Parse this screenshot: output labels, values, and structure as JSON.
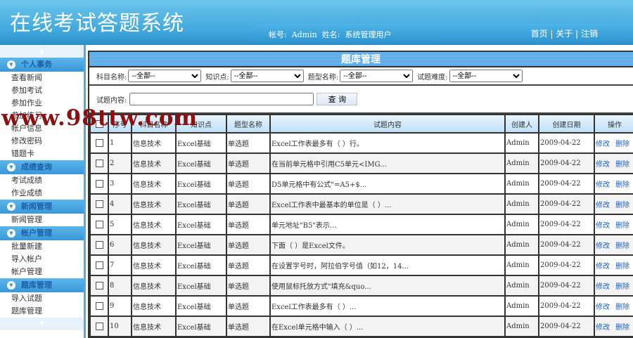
{
  "header": {
    "title": "在线考试答题系统",
    "account_label": "帐号:",
    "account": "Admin",
    "name_label": "姓名:",
    "name": "系统管理用户",
    "links": [
      "首页",
      "关于",
      "注销"
    ]
  },
  "sidebar": {
    "sections": [
      {
        "title": "个人事务",
        "items": [
          "查看新闻",
          "参加考试",
          "参加作业",
          "参加练习",
          "帐户信息",
          "修改密码",
          "错题卡"
        ]
      },
      {
        "title": "成绩查询",
        "items": [
          "考试成绩",
          "作业成绩"
        ]
      },
      {
        "title": "新闻管理",
        "items": [
          "新闻管理"
        ]
      },
      {
        "title": "帐户管理",
        "items": [
          "批量新建",
          "导入帐户",
          "帐户管理"
        ]
      },
      {
        "title": "题库管理",
        "items": [
          "导入试题",
          "题库管理"
        ]
      }
    ]
  },
  "panel": {
    "title": "题库管理",
    "filters": {
      "subject_label": "科目名称:",
      "subject": "--全部--",
      "knowledge_label": "知识点:",
      "knowledge": "--全部--",
      "type_label": "题型名称:",
      "type": "--全部--",
      "difficulty_label": "试题难度:",
      "difficulty": "--全部--",
      "content_label": "试题内容:",
      "content": "",
      "query": "查 询"
    },
    "columns": [
      "序号",
      "科目名称",
      "知识点",
      "题型名称",
      "试题内容",
      "创建人",
      "创建日期",
      "操作"
    ],
    "actions": [
      "修改",
      "删除"
    ],
    "rows": [
      [
        "1",
        "信息技术",
        "Excel基础",
        "单选题",
        "Excel工作表最多有（ ）行。",
        "Admin",
        "2009-04-22"
      ],
      [
        "2",
        "信息技术",
        "Excel基础",
        "单选题",
        "在当前单元格中引用C5单元<IMG...",
        "Admin",
        "2009-04-22"
      ],
      [
        "3",
        "信息技术",
        "Excel基础",
        "单选题",
        "D5单元格中有公式\"=A5+$...",
        "Admin",
        "2009-04-22"
      ],
      [
        "4",
        "信息技术",
        "Excel基础",
        "单选题",
        "Excel工作表中最基本的单位是（    ）...",
        "Admin",
        "2009-04-22"
      ],
      [
        "5",
        "信息技术",
        "Excel基础",
        "单选题",
        "单元地址\"B5\"表示...",
        "Admin",
        "2009-04-22"
      ],
      [
        "6",
        "信息技术",
        "Excel基础",
        "单选题",
        "下面（ ）是Excel文件。",
        "Admin",
        "2009-04-22"
      ],
      [
        "7",
        "信息技术",
        "Excel基础",
        "单选题",
        "在设置字号时，阿拉伯字号值（如12，14...",
        "Admin",
        "2009-04-22"
      ],
      [
        "8",
        "信息技术",
        "Excel基础",
        "单选题",
        "使用鼠标托放方式\"填充&quo...",
        "Admin",
        "2009-04-22"
      ],
      [
        "9",
        "信息技术",
        "Excel基础",
        "单选题",
        "Excel工作表最多有（ ）...",
        "Admin",
        "2009-04-22"
      ],
      [
        "10",
        "信息技术",
        "Excel基础",
        "单选题",
        "在Excel单元格中输入（ ）...",
        "Admin",
        "2009-04-22"
      ]
    ]
  },
  "watermark": "www.98ttw.com"
}
